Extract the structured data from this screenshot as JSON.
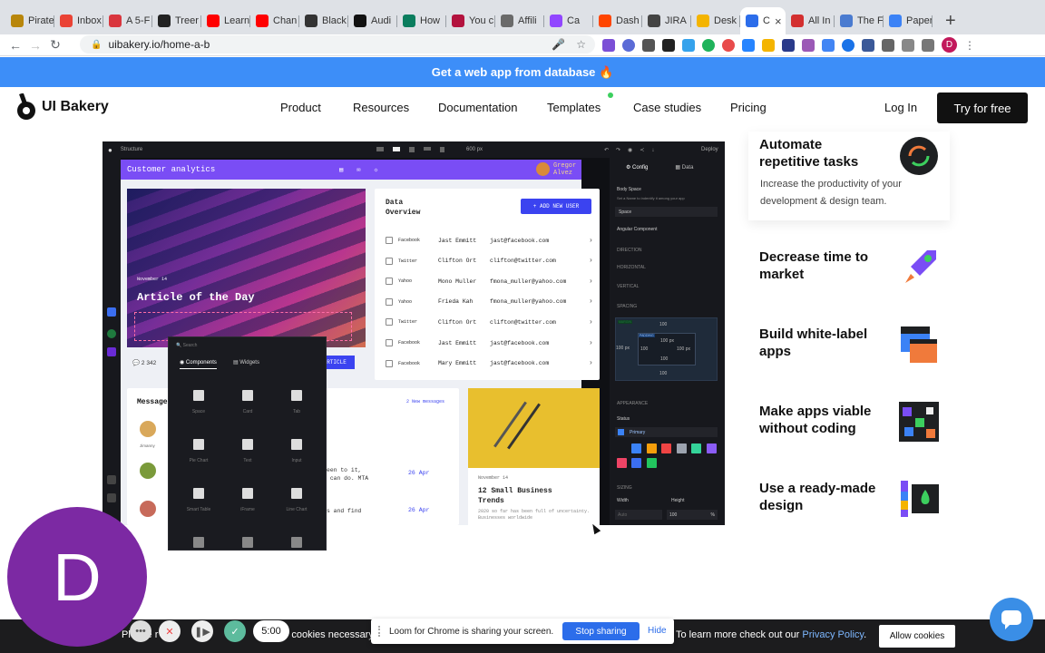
{
  "browser": {
    "tabs": [
      {
        "label": "Pirate",
        "color": "#b8860b"
      },
      {
        "label": "Inbox",
        "color": "#ea4335"
      },
      {
        "label": "A 5-F",
        "color": "#d9363e"
      },
      {
        "label": "Treer",
        "color": "#222222"
      },
      {
        "label": "Learn",
        "color": "#ff0000"
      },
      {
        "label": "Chan",
        "color": "#ff0000"
      },
      {
        "label": "Black",
        "color": "#333333"
      },
      {
        "label": "Audi",
        "color": "#111111"
      },
      {
        "label": "How",
        "color": "#0a7d5e"
      },
      {
        "label": "You c",
        "color": "#b3123e"
      },
      {
        "label": "Affili",
        "color": "#6a6a6a"
      },
      {
        "label": "Ca",
        "color": "#9146ff"
      },
      {
        "label": "Dash",
        "color": "#ff4500"
      },
      {
        "label": "JIRA",
        "color": "#444444"
      },
      {
        "label": "Desk",
        "color": "#f4b400"
      },
      {
        "label": "C",
        "color": "#2c6dea",
        "active": true
      },
      {
        "label": "All In",
        "color": "#d32f2f"
      },
      {
        "label": "The F",
        "color": "#4a7bd0"
      },
      {
        "label": "Paper",
        "color": "#3b82f6"
      }
    ],
    "url": "uibakery.io/home-a-b",
    "profile_initial": "D",
    "new_tab": "+"
  },
  "banner": {
    "text": "Get a web app from database 🔥"
  },
  "nav": {
    "brand": "UI Bakery",
    "links": [
      "Product",
      "Resources",
      "Documentation",
      "Templates",
      "Case studies",
      "Pricing"
    ],
    "login": "Log In",
    "cta": "Try for free"
  },
  "mock": {
    "topbar_label": "Structure",
    "topbar_zoom": "600 px",
    "deploy": "Deploy",
    "app_title": "Customer analytics",
    "user_name": "Gregor Alvez",
    "hero": {
      "date": "November 14",
      "title": "Article of the Day"
    },
    "comments": "2",
    "likes": "342",
    "read_btn": "RTICLE",
    "overview_title": "Data Overview",
    "add_user": "+ ADD NEW USER",
    "users": [
      {
        "source": "Facebook",
        "name": "Jast Emmitt",
        "email": "jast@facebook.com"
      },
      {
        "source": "Twitter",
        "name": "Clifton Ort",
        "email": "clifton@twitter.com"
      },
      {
        "source": "Yahoo",
        "name": "Mono Muller",
        "email": "fmona_muller@yahoo.com"
      },
      {
        "source": "Yahoo",
        "name": "Frieda Kah",
        "email": "fmona_muller@yahoo.com"
      },
      {
        "source": "Twitter",
        "name": "Clifton Ort",
        "email": "clifton@twitter.com"
      },
      {
        "source": "Facebook",
        "name": "Jast Emmitt",
        "email": "jast@facebook.com"
      },
      {
        "source": "Facebook",
        "name": "Mary Emmitt",
        "email": "jast@facebook.com"
      }
    ],
    "messages_label": "Message",
    "new_messages": "2 New messages",
    "avatar_name": "Jimanny",
    "msg1": "have been to it,\nhat it can do. MTA",
    "msg1_date": "26 Apr",
    "msg2": "d files and find",
    "msg2_date": "26 Apr",
    "article2": {
      "date": "November 14",
      "title": "12 Small Business\nTrends",
      "snippet": "2020 so far has been full of uncertainty. Businesses worldwide"
    },
    "picker": {
      "search": "Search",
      "tab_components": "Components",
      "tab_widgets": "Widgets",
      "items": [
        "Space",
        "Card",
        "Tab",
        "Pie Chart",
        "Text",
        "Input",
        "Smart Table",
        "iFrame",
        "Line Chart"
      ]
    },
    "panel": {
      "tab_config": "Config",
      "tab_data": "Data",
      "body_space": "Body Space",
      "name_hint": "Set a Name to indentify it among your app",
      "name_value": "Space",
      "angular": "Angular Component",
      "direction": "DIRECTION",
      "horizontal": "HORIZONTAL",
      "vertical": "VERTICAL",
      "spacing": "SPACING",
      "margin": "MARGIN",
      "padding": "PADDING",
      "val100": "100",
      "val100px": "100 px",
      "appearance": "APPEARANCE",
      "status": "Status",
      "primary": "Primary",
      "sizing": "SIZING",
      "width": "Width",
      "height": "Height",
      "auto": "Auto",
      "height_val": "100",
      "height_unit": "%",
      "colors": [
        "#3b82f6",
        "#f59e0b",
        "#ef4444",
        "#9ca3af",
        "#34d399",
        "#8b5cf6",
        "#ef4466",
        "#3b6ef0",
        "#22c55e"
      ]
    }
  },
  "features": [
    {
      "title": "Automate\nrepetitive tasks",
      "subtitle": "Increase the productivity of your\ndevelopment & design team."
    },
    {
      "title": "Decrease time to\nmarket"
    },
    {
      "title": "Build white-label\napps"
    },
    {
      "title": "Make apps viable\nwithout coding"
    },
    {
      "title": "Use a ready-made\ndesign"
    }
  ],
  "cookie": {
    "left_text": "Please r",
    "left_text_2": "cookies necessary",
    "right_text": "To learn more check out our",
    "policy": "Privacy Policy",
    "allow": "Allow cookies"
  },
  "loom": {
    "message": "Loom for Chrome is sharing your screen.",
    "stop": "Stop sharing",
    "hide": "Hide",
    "timer": "5:00",
    "bubble_initial": "D"
  }
}
